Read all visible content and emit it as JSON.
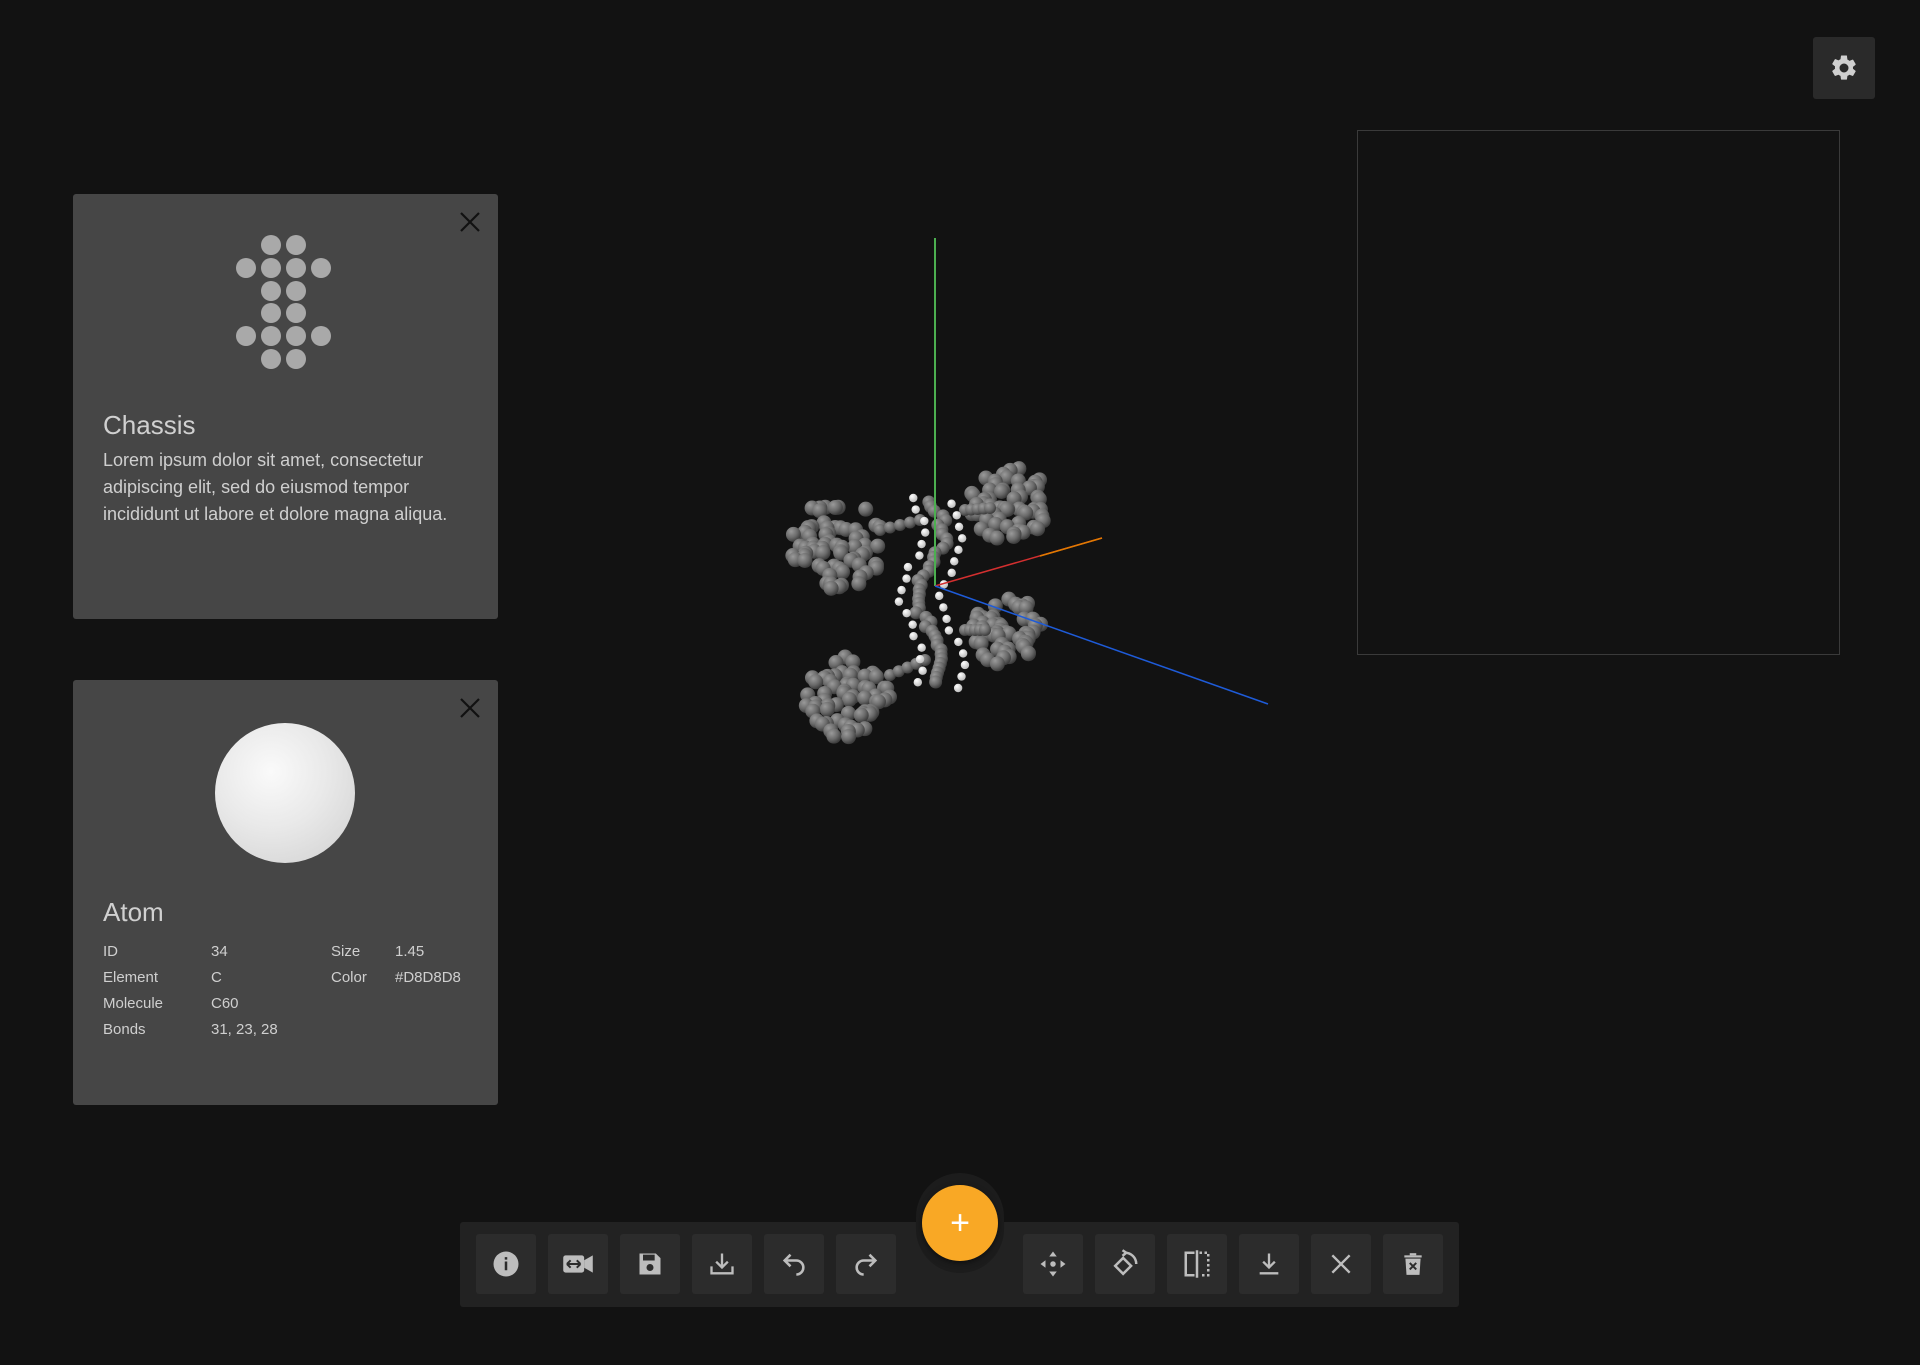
{
  "settings": {
    "icon": "gear-icon"
  },
  "chassis_card": {
    "title": "Chassis",
    "description": "Lorem ipsum dolor sit amet, consectetur adipiscing elit, sed do eiusmod tempor incididunt ut labore et dolore magna aliqua.",
    "icon": "chassis-dots-icon",
    "close_icon": "close-icon"
  },
  "atom_card": {
    "title": "Atom",
    "close_icon": "close-icon",
    "properties": {
      "id_label": "ID",
      "id_value": "34",
      "element_label": "Element",
      "element_value": "C",
      "molecule_label": "Molecule",
      "molecule_value": "C60",
      "bonds_label": "Bonds",
      "bonds_value": "31, 23, 28",
      "size_label": "Size",
      "size_value": "1.45",
      "color_label": "Color",
      "color_value": "#D8D8D8"
    }
  },
  "toolbar": {
    "tools_left": [
      "info-icon",
      "camera-swap-icon",
      "save-icon",
      "download-icon",
      "undo-icon",
      "redo-icon"
    ],
    "add_button": "+",
    "tools_right": [
      "move-icon",
      "rotate-icon",
      "mirror-icon",
      "drop-icon",
      "close-icon",
      "delete-icon"
    ]
  },
  "colors": {
    "accent": "#F9A825",
    "axis_x": "#D32F2F",
    "axis_y": "#4CAF50",
    "axis_z": "#1E5BD8",
    "axis_extra": "#E07B00"
  }
}
